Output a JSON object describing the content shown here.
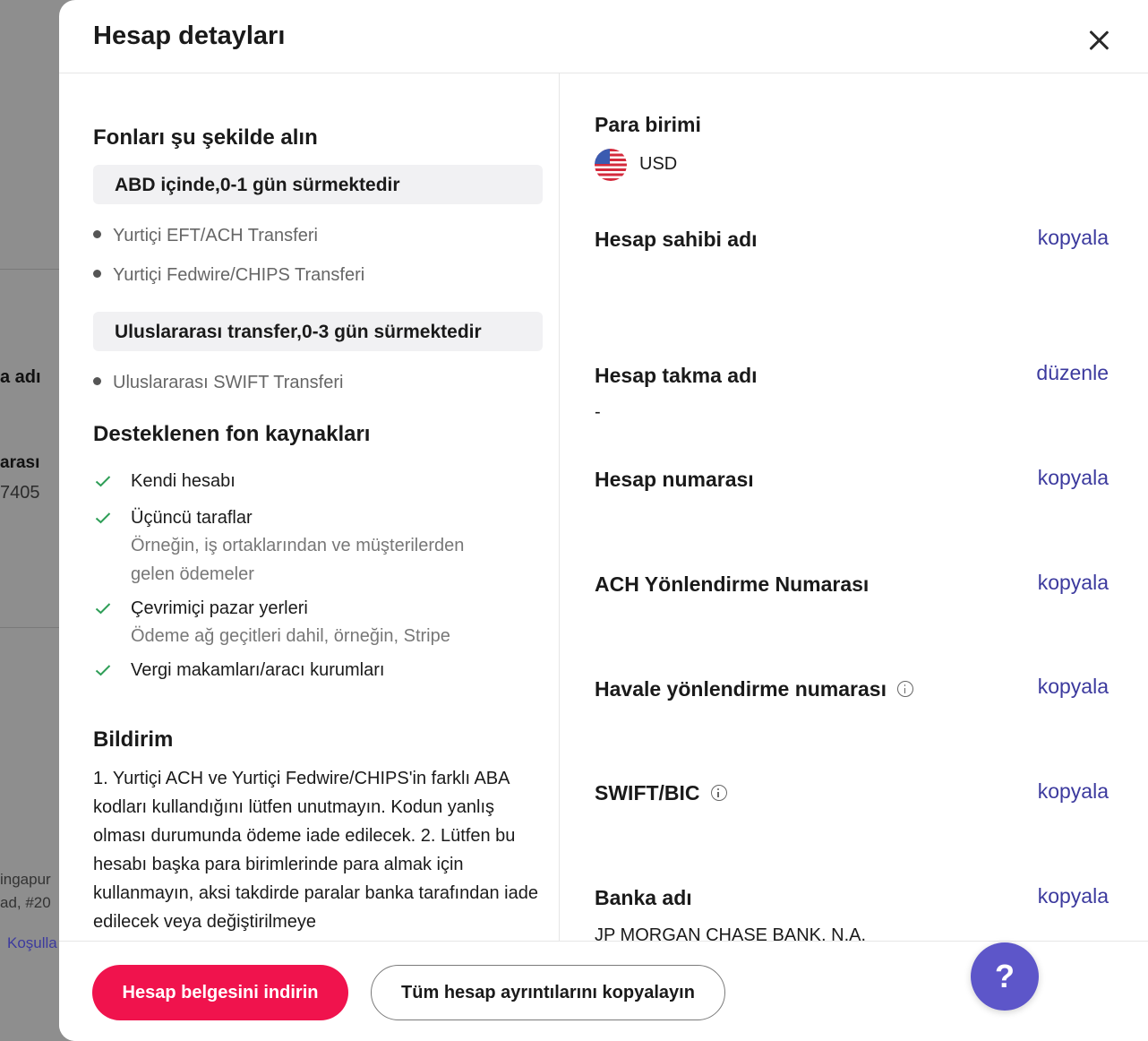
{
  "background": {
    "items": [
      {
        "text": "a adı"
      },
      {
        "text": "arası"
      },
      {
        "text": "7405"
      },
      {
        "text": "ingapur"
      },
      {
        "text": "ad, #20"
      },
      {
        "text": "Koşulla"
      }
    ]
  },
  "modal": {
    "title": "Hesap detayları",
    "close_label": "✕"
  },
  "left": {
    "receive_heading": "Fonları şu şekilde alın",
    "domestic": {
      "label": "ABD içinde,0-1 gün sürmektedir",
      "methods": [
        "Yurtiçi EFT/ACH Transferi",
        "Yurtiçi Fedwire/CHIPS Transferi"
      ]
    },
    "international": {
      "label": "Uluslararası transfer,0-3 gün sürmektedir",
      "methods": [
        "Uluslararası SWIFT Transferi"
      ]
    },
    "sources_heading": "Desteklenen fon kaynakları",
    "sources": [
      {
        "title": "Kendi hesabı",
        "sub1": "",
        "sub2": ""
      },
      {
        "title": "Üçüncü taraflar",
        "sub1": "Örneğin, iş ortaklarından ve müşterilerden",
        "sub2": "gelen ödemeler"
      },
      {
        "title": "Çevrimiçi pazar yerleri",
        "sub1": "Ödeme ağ geçitleri dahil, örneğin, Stripe",
        "sub2": ""
      },
      {
        "title": "Vergi makamları/aracı kurumları",
        "sub1": "",
        "sub2": ""
      }
    ],
    "notice_heading": "Bildirim",
    "notice_text": "1. Yurtiçi ACH ve Yurtiçi Fedwire/CHIPS'in farklı ABA kodları kullandığını lütfen unutmayın. Kodun yanlış olması durumunda ödeme iade edilecek. 2. Lütfen bu hesabı başka para birimlerinde para almak için kullanmayın, aksi takdirde paralar banka tarafından iade edilecek veya değiştirilmeye"
  },
  "right": {
    "currency_label": "Para birimi",
    "currency_value": "USD",
    "fields": [
      {
        "label": "Hesap sahibi adı",
        "action": "kopyala",
        "value": ""
      },
      {
        "label": "Hesap takma adı",
        "action": "düzenle",
        "value": "-"
      },
      {
        "label": "Hesap numarası",
        "action": "kopyala",
        "value": ""
      },
      {
        "label": "ACH Yönlendirme Numarası",
        "action": "kopyala",
        "value": ""
      },
      {
        "label": "Havale yönlendirme numarası",
        "action": "kopyala",
        "value": ""
      },
      {
        "label": "SWIFT/BIC",
        "action": "kopyala",
        "value": ""
      },
      {
        "label": "Banka adı",
        "action": "kopyala",
        "value": "JP MORGAN CHASE BANK, N.A."
      }
    ]
  },
  "footer": {
    "download_label": "Hesap belgesini indirin",
    "copy_all_label": "Tüm hesap ayrıntılarını kopyalayın"
  },
  "help": {
    "label": "?"
  },
  "colors": {
    "primary": "#f0134d",
    "link": "#3c3a9e",
    "help": "#5d56c9",
    "check": "#2e9e57"
  }
}
